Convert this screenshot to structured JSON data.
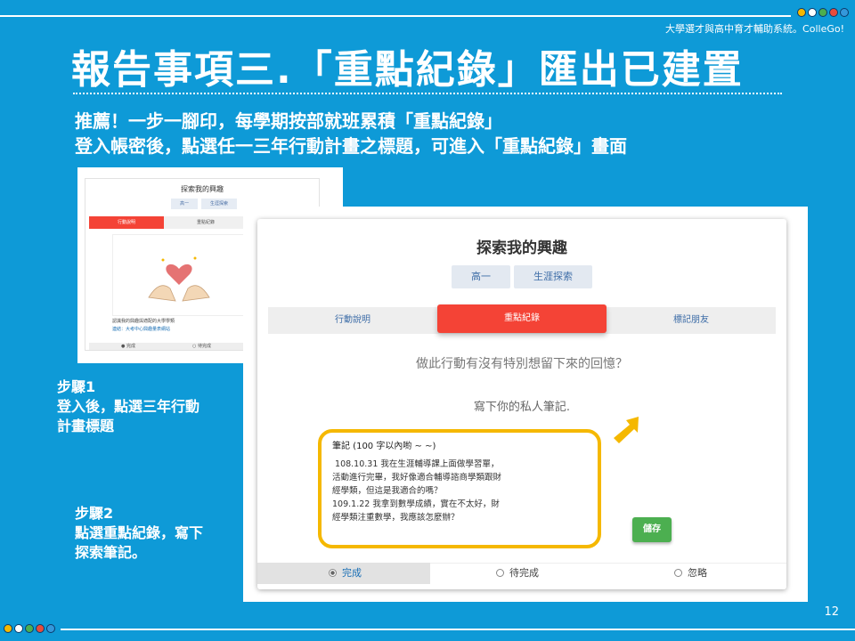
{
  "header": {
    "brand": "大學選才與高中育才輔助系統。ColleGo!",
    "title": "報告事項三.「重點紀錄」匯出已建置",
    "intro_line1": "推薦！一步一腳印，每學期按部就班累積「重點紀錄」",
    "intro_line2": "登入帳密後，點選任一三年行動計畫之標題，可進入「重點紀錄」畫面"
  },
  "logo_icons": [
    "colorful-circle-logo-icon"
  ],
  "small_screenshot": {
    "title": "探索我的興趣",
    "chip1": "高一",
    "chip2": "生涯探索",
    "tab_active": "行動說明",
    "tab2": "重點紀錄",
    "text1": "認識我的興趣與適配的大學學類",
    "text2": "連結：大考中心興趣量表網站",
    "bottom1": "● 完成",
    "bottom2": "○ 待完成"
  },
  "steps": {
    "step1_line1": "步驟1",
    "step1_line2": "登入後，點選三年行動",
    "step1_line3": "計畫標題",
    "step2_line1": "步驟2",
    "step2_line2": "點選重點紀錄，寫下",
    "step2_line3": "探索筆記。"
  },
  "main_screenshot": {
    "title": "探索我的興趣",
    "chip_grade": "高一",
    "chip_category": "生涯探索",
    "tab_explain": "行動說明",
    "tab_record": "重點紀錄",
    "tab_friends": "標記朋友",
    "question": "做此行動有沒有特別想留下來的回憶？",
    "subtitle": "寫下你的私人筆記.",
    "note_label": "筆記 (100 字以內喲 ~ ~)",
    "note_text": " 108.10.31 我在生涯輔導課上面做學習單，\n活動進行完畢，我好像適合輔導諮商學類跟財\n經學類，但這是我適合的嗎？\n109.1.22 我拿到數學成績，實在不太好，財\n經學類注重數學，我應該怎麼辦？",
    "save_label": "儲存",
    "status_done": "完成",
    "status_pending": "待完成",
    "status_ignore": "忽略",
    "selected_status": "完成"
  },
  "page_number": "12",
  "colors": {
    "background": "#0e9ad7",
    "active_tab": "#f44336",
    "save": "#4caf50",
    "highlight": "#f5b800"
  }
}
